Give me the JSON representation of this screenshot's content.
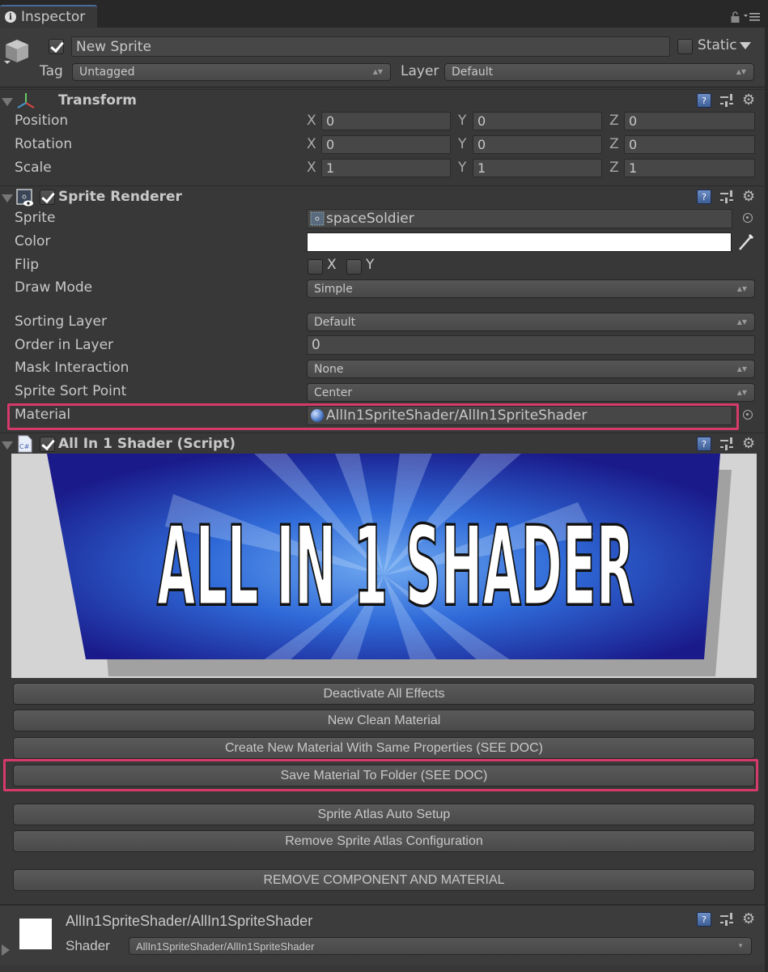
{
  "window": {
    "tab_label": "Inspector"
  },
  "gameobject": {
    "active": true,
    "name": "New Sprite",
    "static_label": "Static",
    "static_checked": false,
    "tag_label": "Tag",
    "tag_value": "Untagged",
    "layer_label": "Layer",
    "layer_value": "Default"
  },
  "transform": {
    "title": "Transform",
    "rows": [
      {
        "label": "Position",
        "x": "0",
        "y": "0",
        "z": "0"
      },
      {
        "label": "Rotation",
        "x": "0",
        "y": "0",
        "z": "0"
      },
      {
        "label": "Scale",
        "x": "1",
        "y": "1",
        "z": "1"
      }
    ],
    "axis_x": "X",
    "axis_y": "Y",
    "axis_z": "Z"
  },
  "sprite_renderer": {
    "title": "Sprite Renderer",
    "enabled": true,
    "sprite_label": "Sprite",
    "sprite_value": "spaceSoldier",
    "color_label": "Color",
    "color_value": "#ffffff",
    "flip_label": "Flip",
    "flip_x_label": "X",
    "flip_y_label": "Y",
    "draw_mode_label": "Draw Mode",
    "draw_mode_value": "Simple",
    "sorting_layer_label": "Sorting Layer",
    "sorting_layer_value": "Default",
    "order_label": "Order in Layer",
    "order_value": "0",
    "mask_label": "Mask Interaction",
    "mask_value": "None",
    "sort_point_label": "Sprite Sort Point",
    "sort_point_value": "Center",
    "material_label": "Material",
    "material_value": "AllIn1SpriteShader/AllIn1SpriteShader"
  },
  "shader_script": {
    "title": "All In 1 Shader (Script)",
    "enabled": true,
    "banner_text": "ALL IN 1 SHADER",
    "buttons": [
      "Deactivate All Effects",
      "New Clean Material",
      "Create New Material With Same Properties (SEE DOC)",
      "Save Material To Folder (SEE DOC)",
      "Sprite Atlas Auto Setup",
      "Remove Sprite Atlas Configuration",
      "REMOVE COMPONENT AND MATERIAL"
    ]
  },
  "material_panel": {
    "title": "AllIn1SpriteShader/AllIn1SpriteShader",
    "shader_label": "Shader",
    "shader_value": "AllIn1SpriteShader/AllIn1SpriteShader"
  },
  "colors": {
    "highlight": "#d63a6a",
    "background": "#383838"
  }
}
